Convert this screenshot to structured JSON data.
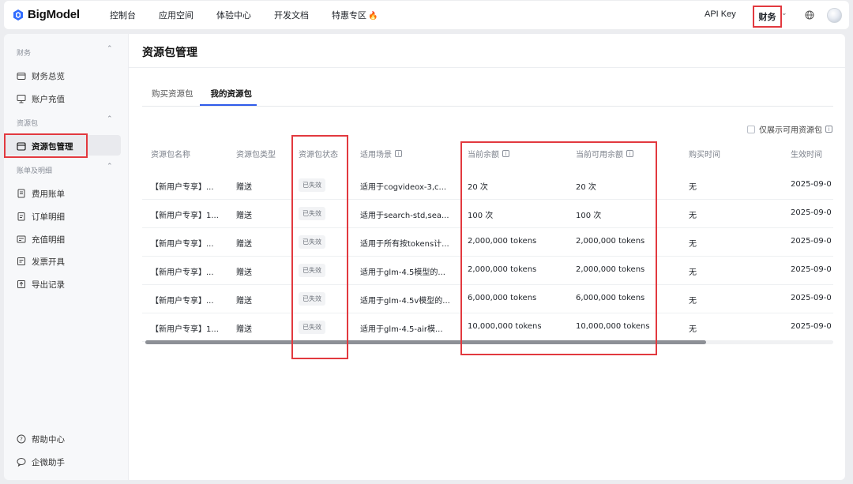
{
  "app": {
    "brand": "BigModel",
    "nav": [
      {
        "label": "控制台"
      },
      {
        "label": "应用空间"
      },
      {
        "label": "体验中心"
      },
      {
        "label": "开发文档"
      },
      {
        "label": "特惠专区",
        "badge_icon": "fire-icon"
      }
    ],
    "api_key": "API Key",
    "finance": "财务",
    "accent_color": "#2f5bea",
    "highlight_color": "#e2393f"
  },
  "sidebar": {
    "sections": [
      {
        "title": "财务",
        "items": [
          {
            "label": "财务总览",
            "icon": "wallet-icon"
          },
          {
            "label": "账户充值",
            "icon": "recharge-icon"
          }
        ]
      },
      {
        "title": "资源包",
        "items": [
          {
            "label": "资源包管理",
            "icon": "package-icon",
            "active": true
          }
        ]
      },
      {
        "title": "账单及明细",
        "items": [
          {
            "label": "费用账单",
            "icon": "bill-icon"
          },
          {
            "label": "订单明细",
            "icon": "order-icon"
          },
          {
            "label": "充值明细",
            "icon": "recharge-detail-icon"
          },
          {
            "label": "发票开具",
            "icon": "invoice-icon"
          },
          {
            "label": "导出记录",
            "icon": "export-icon"
          }
        ]
      }
    ],
    "footer": [
      {
        "label": "帮助中心",
        "icon": "help-icon"
      },
      {
        "label": "企微助手",
        "icon": "chat-icon"
      }
    ]
  },
  "main": {
    "title": "资源包管理",
    "tabs": [
      {
        "label": "购买资源包"
      },
      {
        "label": "我的资源包",
        "active": true
      }
    ],
    "filter_label": "仅展示可用资源包",
    "columns": [
      "资源包名称",
      "资源包类型",
      "资源包状态",
      "适用场景",
      "当前余额",
      "当前可用余额",
      "购买时间",
      "生效时间"
    ],
    "rows": [
      {
        "name": "【新用户专享】...",
        "type": "赠送",
        "status": "已失效",
        "scene": "适用于cogvideox-3,c...",
        "balance": "20 次",
        "available": "20 次",
        "purchase": "无",
        "effective": "2025-09-0"
      },
      {
        "name": "【新用户专享】1...",
        "type": "赠送",
        "status": "已失效",
        "scene": "适用于search-std,sea...",
        "balance": "100 次",
        "available": "100 次",
        "purchase": "无",
        "effective": "2025-09-0"
      },
      {
        "name": "【新用户专享】...",
        "type": "赠送",
        "status": "已失效",
        "scene": "适用于所有按tokens计...",
        "balance": "2,000,000 tokens",
        "available": "2,000,000 tokens",
        "purchase": "无",
        "effective": "2025-09-0"
      },
      {
        "name": "【新用户专享】...",
        "type": "赠送",
        "status": "已失效",
        "scene": "适用于glm-4.5模型的...",
        "balance": "2,000,000 tokens",
        "available": "2,000,000 tokens",
        "purchase": "无",
        "effective": "2025-09-0"
      },
      {
        "name": "【新用户专享】...",
        "type": "赠送",
        "status": "已失效",
        "scene": "适用于glm-4.5v模型的...",
        "balance": "6,000,000 tokens",
        "available": "6,000,000 tokens",
        "purchase": "无",
        "effective": "2025-09-0"
      },
      {
        "name": "【新用户专享】1...",
        "type": "赠送",
        "status": "已失效",
        "scene": "适用于glm-4.5-air模...",
        "balance": "10,000,000 tokens",
        "available": "10,000,000 tokens",
        "purchase": "无",
        "effective": "2025-09-0"
      }
    ]
  }
}
